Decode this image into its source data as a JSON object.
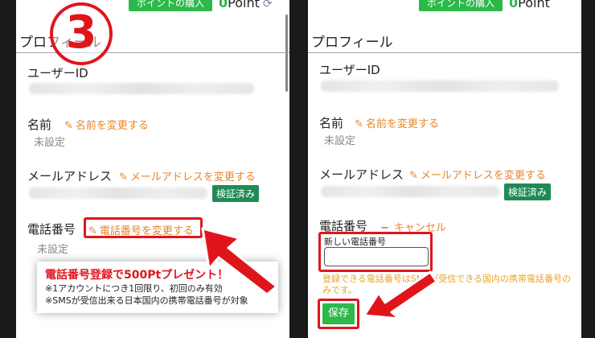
{
  "left": {
    "buy_button": "ポイントの購入",
    "points_zero": "0",
    "points_unit": "Point",
    "refresh_glyph": "⟳",
    "step_number": "3",
    "profile_title": "プロフィール",
    "user_id_label": "ユーザーID",
    "name_label": "名前",
    "name_edit": "名前を変更する",
    "name_value": "未設定",
    "email_label": "メールアドレス",
    "email_edit": "メールアドレスを変更する",
    "email_badge": "検証済み",
    "phone_label": "電話番号",
    "phone_edit": "電話番号を変更する",
    "phone_value": "未設定",
    "promo_title": "電話番号登録で500Ptプレゼント！",
    "promo_line1": "※1アカウントにつき1回限り、初回のみ有効",
    "promo_line2": "※SMSが受信出来る日本国内の携帯電話番号が対象"
  },
  "right": {
    "buy_button": "ポイントの購入",
    "points_zero": "0",
    "points_unit": "Point",
    "refresh_glyph": "⟳",
    "profile_title": "プロフィール",
    "user_id_label": "ユーザーID",
    "name_label": "名前",
    "name_edit": "名前を変更する",
    "name_value": "未設定",
    "email_label": "メールアドレス",
    "email_edit": "メールアドレスを変更する",
    "email_badge": "検証済み",
    "phone_label": "電話番号",
    "cancel_glyph": "−",
    "cancel_label": "キャンセル",
    "new_phone_label": "新しい電話番号",
    "new_phone_value": "",
    "note": "登録できる電話番号はSMSが受信できる国内の携帯電話番号のみです。",
    "save_label": "保存"
  },
  "colors": {
    "accent_green": "#2db84a",
    "badge_green": "#1f8a55",
    "link_orange": "#e8862a",
    "highlight_red": "#e0151c"
  },
  "icons": [
    "pencil-icon",
    "refresh-icon",
    "arrow-annotation"
  ]
}
